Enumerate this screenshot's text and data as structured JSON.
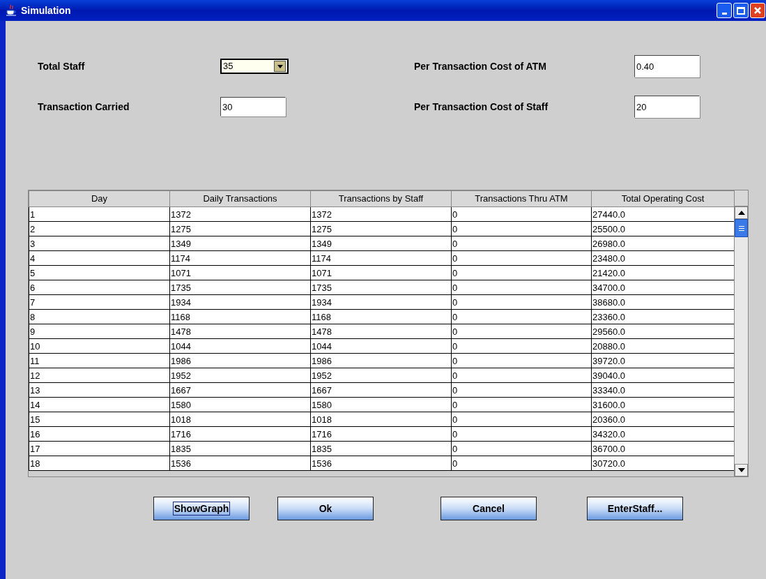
{
  "window": {
    "title": "Simulation"
  },
  "form": [
    {
      "label": "Total Staff",
      "kind": "combo",
      "value": "35"
    },
    {
      "label": "Per Transaction Cost of ATM",
      "kind": "text",
      "value": "0.40"
    },
    {
      "label": "Transaction Carried",
      "kind": "text",
      "value": "30"
    },
    {
      "label": "Per Transaction Cost of Staff",
      "kind": "text",
      "value": "20"
    }
  ],
  "table": {
    "columns": [
      "Day",
      "Daily Transactions",
      "Transactions by Staff",
      "Transactions Thru ATM",
      "Total Operating Cost"
    ],
    "rows": [
      [
        "1",
        "1372",
        "1372",
        "0",
        "27440.0"
      ],
      [
        "2",
        "1275",
        "1275",
        "0",
        "25500.0"
      ],
      [
        "3",
        "1349",
        "1349",
        "0",
        "26980.0"
      ],
      [
        "4",
        "1174",
        "1174",
        "0",
        "23480.0"
      ],
      [
        "5",
        "1071",
        "1071",
        "0",
        "21420.0"
      ],
      [
        "6",
        "1735",
        "1735",
        "0",
        "34700.0"
      ],
      [
        "7",
        "1934",
        "1934",
        "0",
        "38680.0"
      ],
      [
        "8",
        "1168",
        "1168",
        "0",
        "23360.0"
      ],
      [
        "9",
        "1478",
        "1478",
        "0",
        "29560.0"
      ],
      [
        "10",
        "1044",
        "1044",
        "0",
        "20880.0"
      ],
      [
        "11",
        "1986",
        "1986",
        "0",
        "39720.0"
      ],
      [
        "12",
        "1952",
        "1952",
        "0",
        "39040.0"
      ],
      [
        "13",
        "1667",
        "1667",
        "0",
        "33340.0"
      ],
      [
        "14",
        "1580",
        "1580",
        "0",
        "31600.0"
      ],
      [
        "15",
        "1018",
        "1018",
        "0",
        "20360.0"
      ],
      [
        "16",
        "1716",
        "1716",
        "0",
        "34320.0"
      ],
      [
        "17",
        "1835",
        "1835",
        "0",
        "36700.0"
      ],
      [
        "18",
        "1536",
        "1536",
        "0",
        "30720.0"
      ]
    ]
  },
  "buttons": [
    {
      "label": "ShowGraph",
      "focused": true
    },
    {
      "label": "Ok",
      "focused": false
    },
    {
      "label": "Cancel",
      "focused": false
    },
    {
      "label": "EnterStaff...",
      "focused": false
    }
  ]
}
